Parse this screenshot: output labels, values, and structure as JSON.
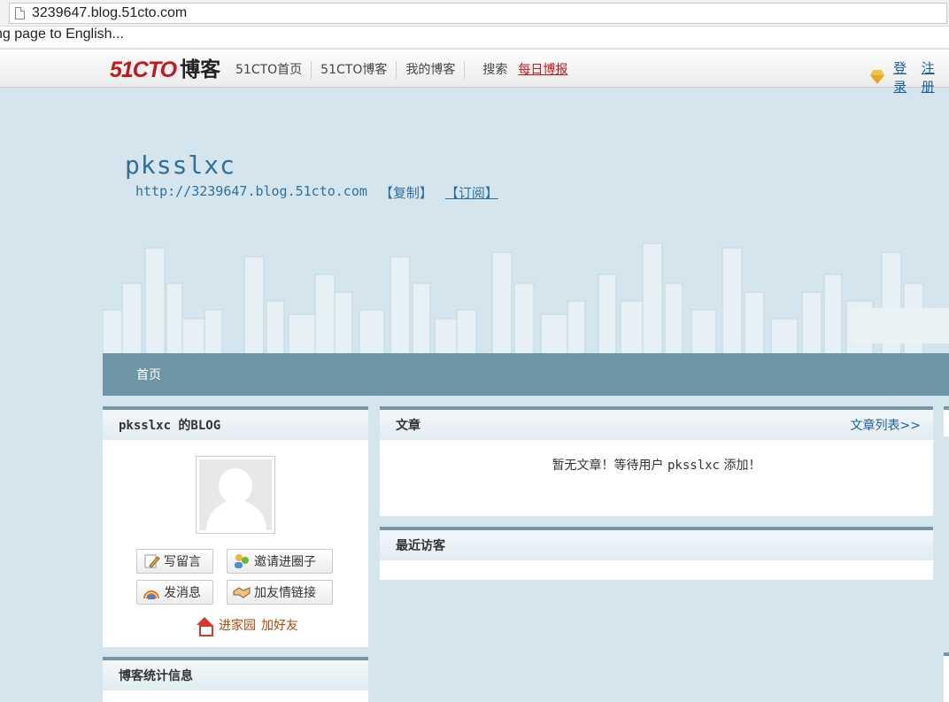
{
  "browser": {
    "url": "3239647.blog.51cto.com",
    "translate_text": "ng page to English..."
  },
  "topnav": {
    "logo_num": "51CTO",
    "logo_text": "博客",
    "links": [
      "51CTO首页",
      "51CTO博客",
      "我的博客"
    ],
    "search": "搜索",
    "daily": "每日博报",
    "login": "登录",
    "register": "注册"
  },
  "header": {
    "title": "pksslxc",
    "url": "http://3239647.blog.51cto.com",
    "copy": "【复制】",
    "subscribe": "【订阅】"
  },
  "blognav": {
    "home": "首页"
  },
  "profile": {
    "heading": "pksslxc 的BLOG",
    "buttons": {
      "message": "写留言",
      "invite": "邀请进圈子",
      "send": "发消息",
      "friend_link": "加友情链接"
    },
    "home_link": "进家园",
    "add_friend": "加好友"
  },
  "stats": {
    "heading": "博客统计信息"
  },
  "articles": {
    "heading": "文章",
    "more": "文章列表>>",
    "empty_prefix": "暂无文章！等待用户",
    "empty_user": "pksslxc",
    "empty_suffix": "添加！"
  },
  "visitors": {
    "heading": "最近访客"
  },
  "colors": {
    "nav_bar": "#6d95a6",
    "page_bg": "#d5e5ee",
    "link": "#1a5e9e",
    "brand_red": "#c8161d"
  }
}
